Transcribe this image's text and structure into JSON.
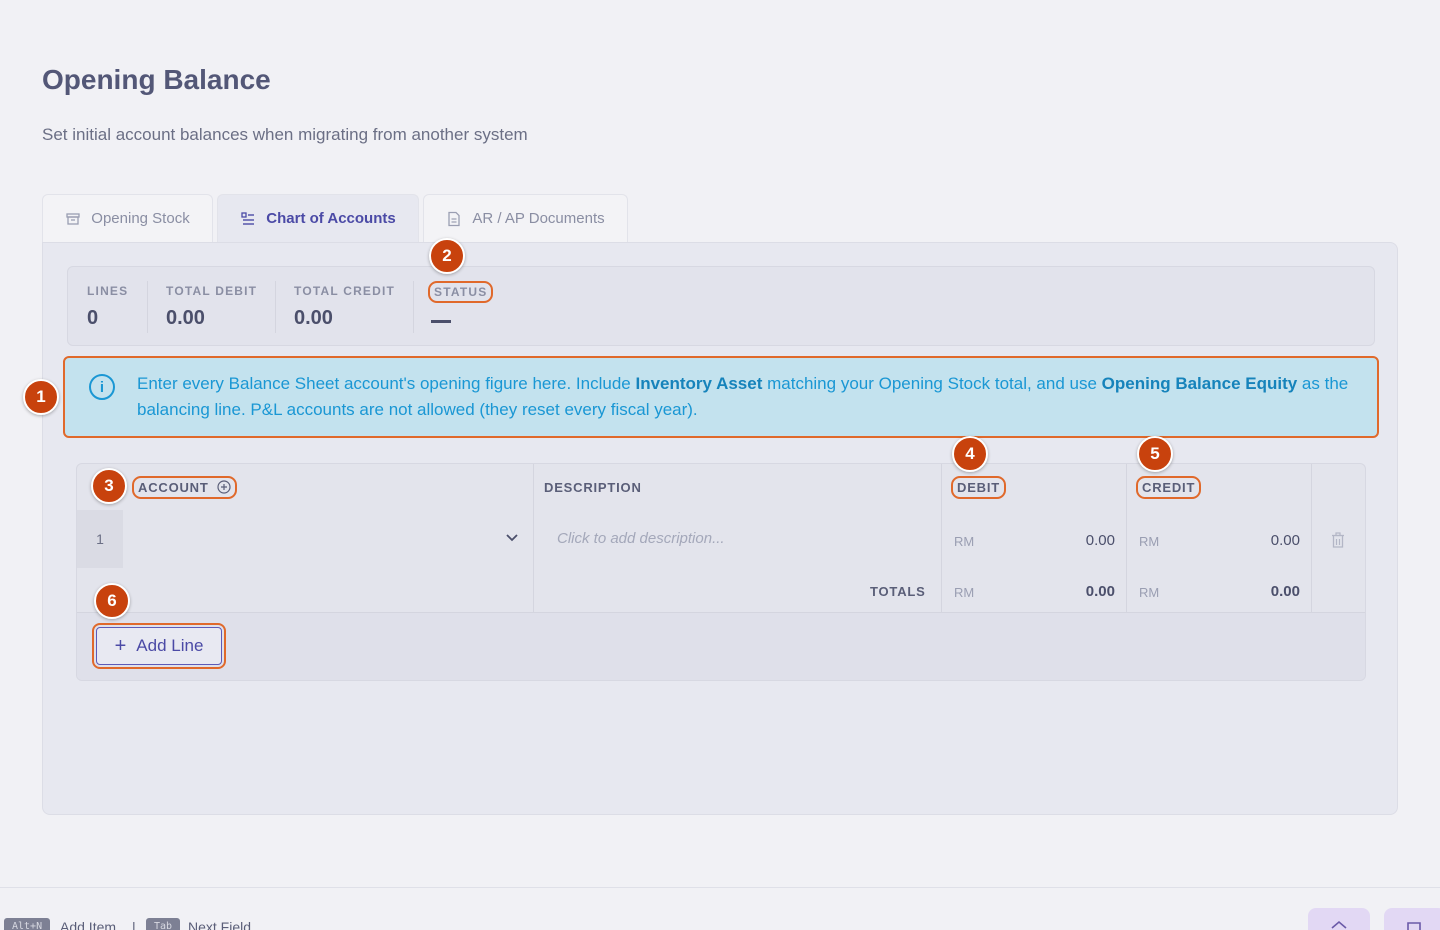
{
  "page": {
    "title": "Opening Balance",
    "subtitle": "Set initial account balances when migrating from another system"
  },
  "tabs": [
    {
      "label": "Opening Stock",
      "icon": "box-icon",
      "active": false
    },
    {
      "label": "Chart of Accounts",
      "icon": "list-icon",
      "active": true
    },
    {
      "label": "AR / AP Documents",
      "icon": "document-icon",
      "active": false
    }
  ],
  "stats": {
    "lines_label": "LINES",
    "lines_value": "0",
    "debit_label": "TOTAL DEBIT",
    "debit_value": "0.00",
    "credit_label": "TOTAL CREDIT",
    "credit_value": "0.00",
    "status_label": "STATUS"
  },
  "info": {
    "part1": "Enter every Balance Sheet account's opening figure here. Include ",
    "bold1": "Inventory Asset",
    "part2": " matching your Opening Stock total, and use ",
    "bold2": "Opening Balance Equity",
    "part3": " as the balancing line. P&L accounts are not allowed (they reset every fiscal year)."
  },
  "table": {
    "col_account": "ACCOUNT",
    "col_description": "DESCRIPTION",
    "col_debit": "DEBIT",
    "col_credit": "CREDIT",
    "rows": [
      {
        "num": "1",
        "description_placeholder": "Click to add description...",
        "debit_currency": "RM",
        "debit": "0.00",
        "credit_currency": "RM",
        "credit": "0.00"
      }
    ],
    "totals_label": "TOTALS",
    "totals_debit_currency": "RM",
    "totals_debit": "0.00",
    "totals_credit_currency": "RM",
    "totals_credit": "0.00"
  },
  "add_line_label": "Add Line",
  "badges": [
    "1",
    "2",
    "3",
    "4",
    "5",
    "6"
  ],
  "footer": {
    "kbd1": "Alt+N",
    "kbd1_label": "Add Item",
    "separator": "|",
    "kbd2": "Tab",
    "kbd2_label": "Next Field"
  },
  "colors": {
    "accent": "#4b4aa6",
    "info": "#1a97d4",
    "annotation": "#e0692b",
    "badge": "#c8420d"
  }
}
